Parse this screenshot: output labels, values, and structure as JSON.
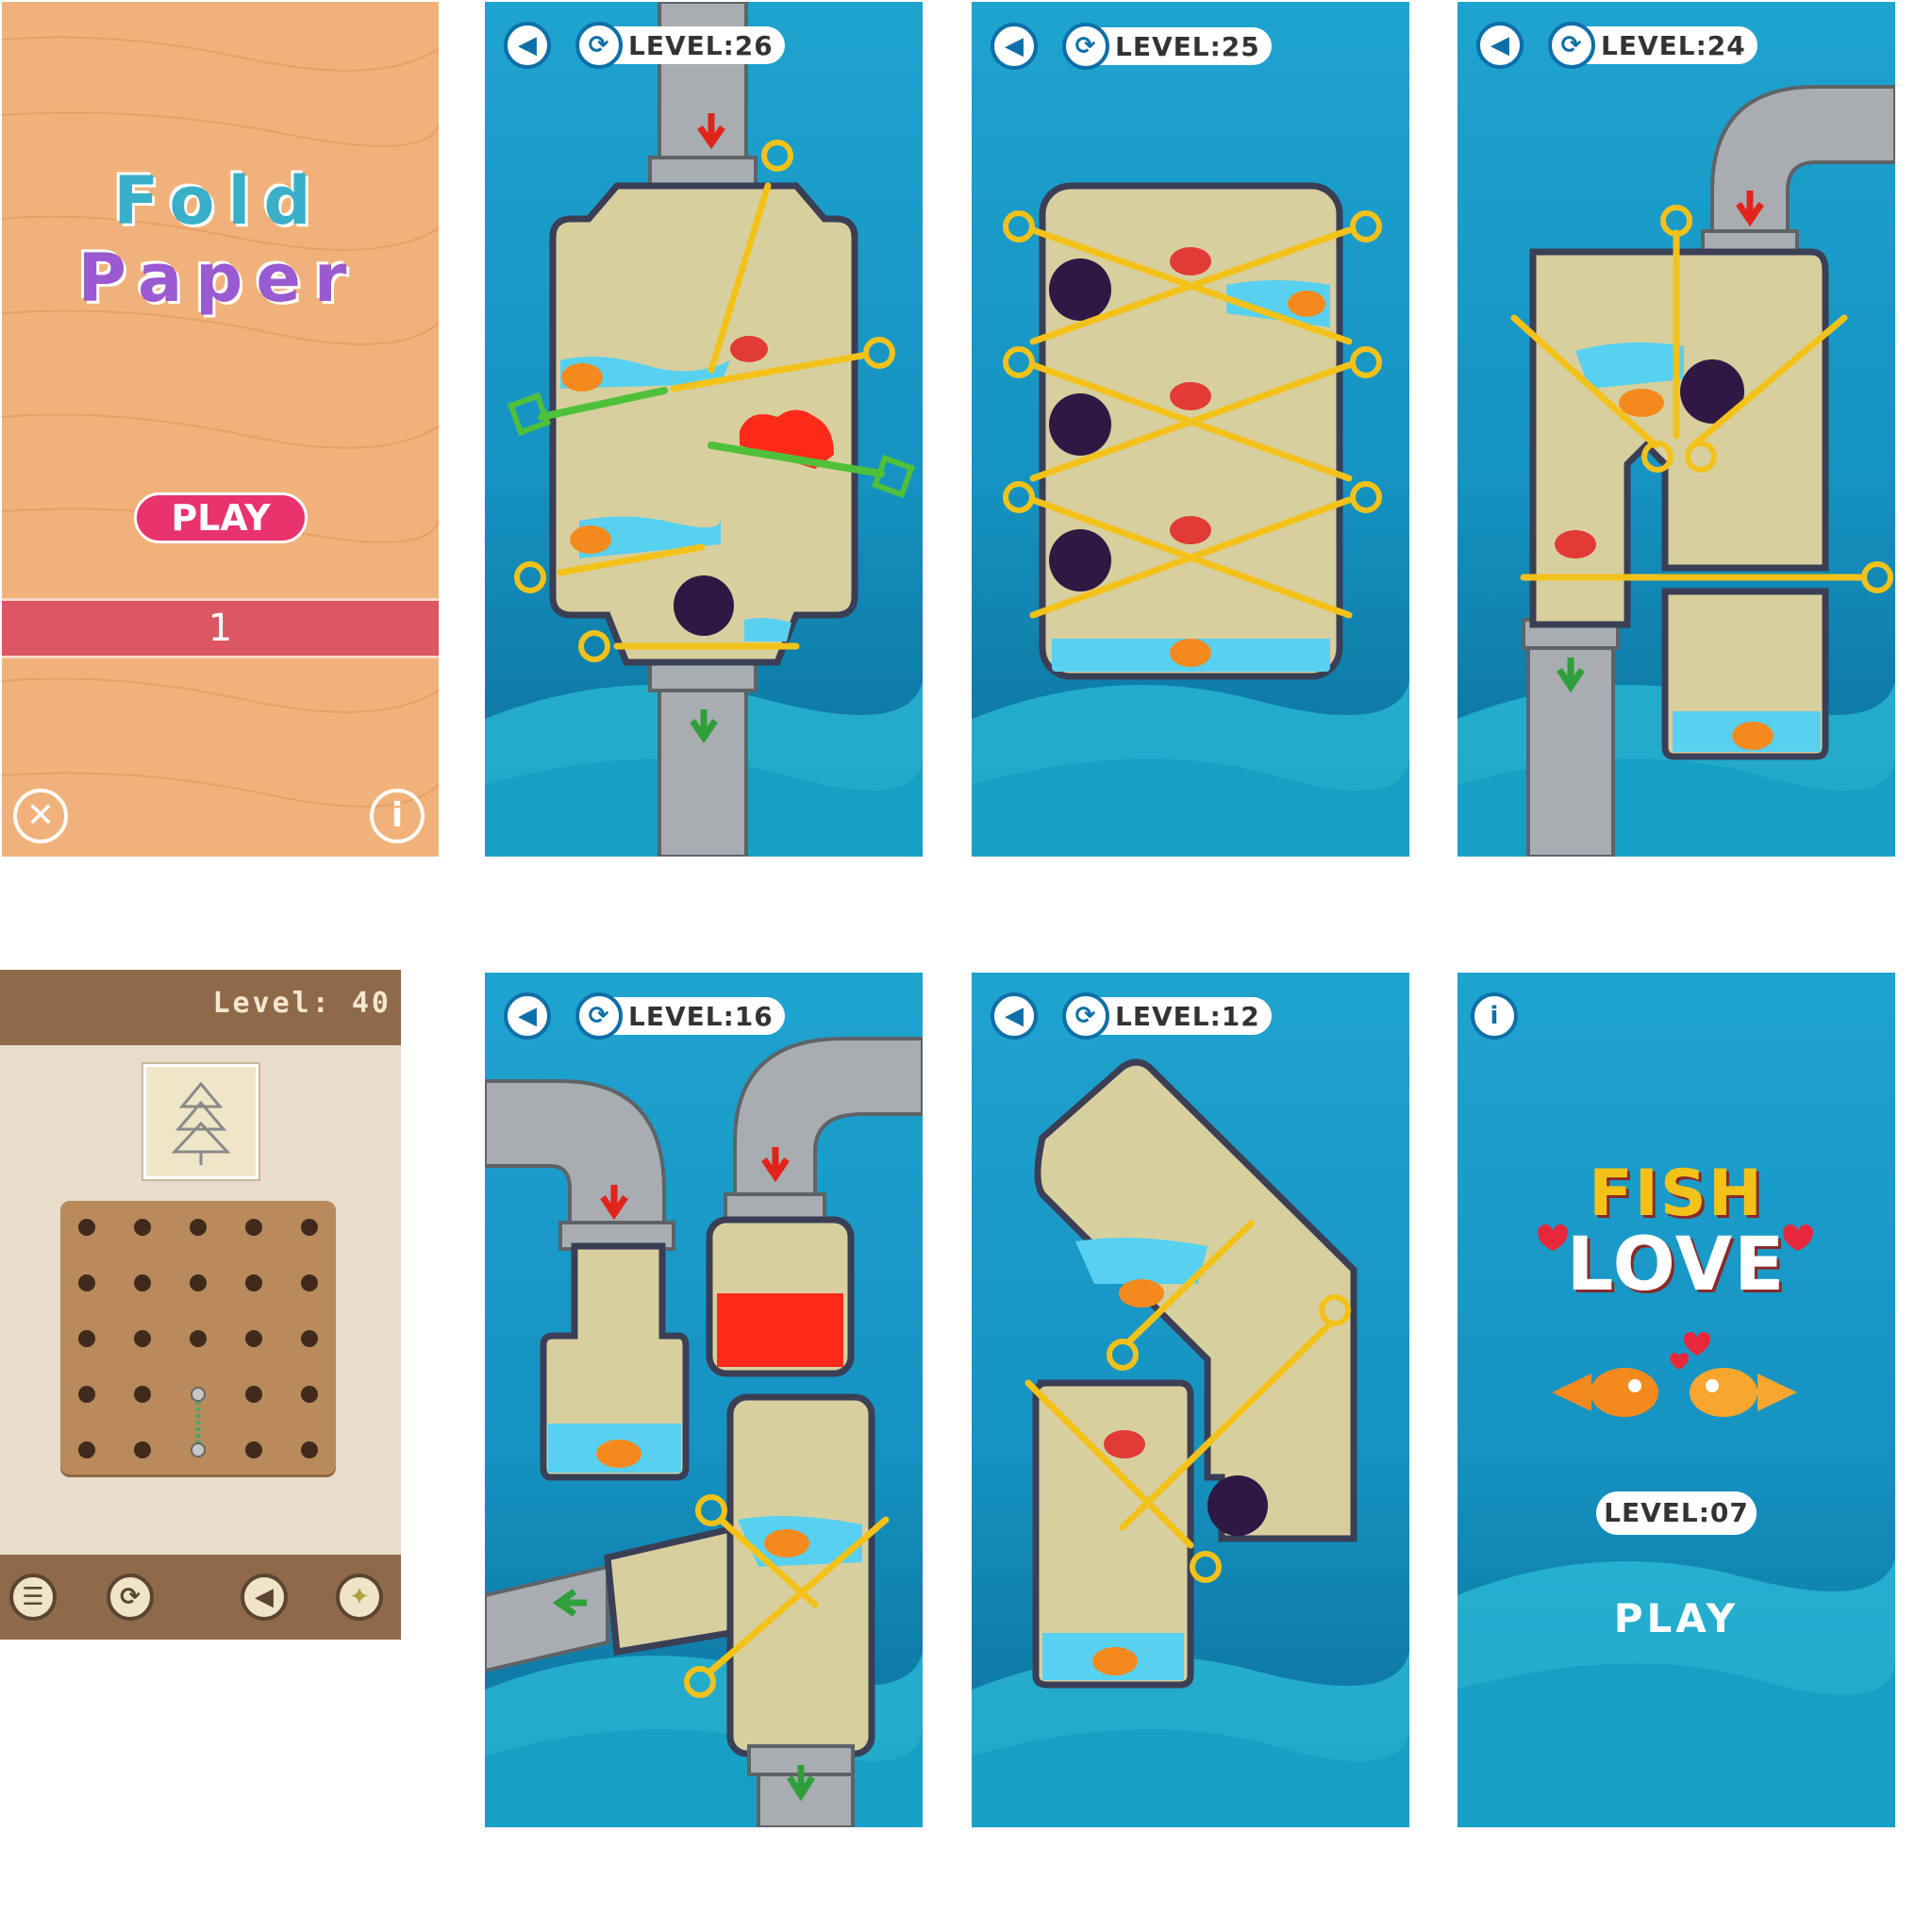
{
  "fold_paper": {
    "title_word1": "Fold",
    "title_word2": "Paper",
    "play_label": "PLAY",
    "level_number": "1",
    "close_icon": "close-icon",
    "info_icon": "info-icon",
    "colors": {
      "wood": "#f0b27a",
      "play": "#e8336d",
      "band": "#dc5663"
    }
  },
  "puzzle_levels": [
    {
      "level_label": "LEVEL:26"
    },
    {
      "level_label": "LEVEL:25"
    },
    {
      "level_label": "LEVEL:24"
    },
    {
      "level_label": "LEVEL:16"
    },
    {
      "level_label": "LEVEL:12"
    }
  ],
  "string_art": {
    "level_label": "Level: 40",
    "toolbar_icons": [
      "menu-icon",
      "restart-icon",
      "back-icon",
      "hint-icon"
    ]
  },
  "fish_love": {
    "title_top": "FISH",
    "title_bottom": "LOVE",
    "level_label": "LEVEL:07",
    "play_label": "PLAY",
    "info_icon": "info-icon"
  },
  "colors": {
    "ocean_top": "#1fa3cf",
    "ocean_bottom": "#0b6d96",
    "sand": "#d8cf9f",
    "pipe": "#a8adb2",
    "pin": "#f3c21a",
    "water": "#58d0f0",
    "lava": "#ff2a1a",
    "bomb": "#2f1844"
  }
}
